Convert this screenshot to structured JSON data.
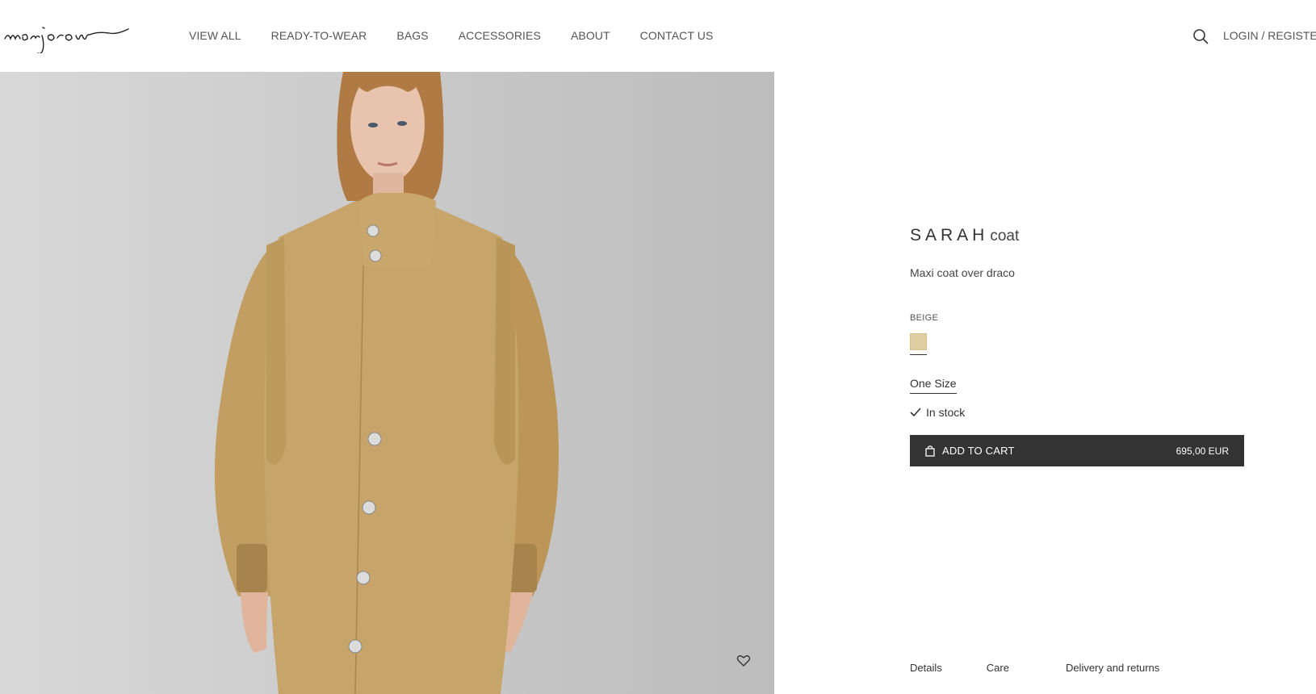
{
  "header": {
    "logo_text": "marjorou",
    "nav": [
      {
        "label": "VIEW ALL"
      },
      {
        "label": "READY-TO-WEAR"
      },
      {
        "label": "BAGS"
      },
      {
        "label": "ACCESSORIES"
      },
      {
        "label": "ABOUT"
      },
      {
        "label": "CONTACT US"
      }
    ],
    "search_icon": "search-icon",
    "login_label": "LOGIN / REGISTER"
  },
  "gallery": {
    "image_subject": "model wearing beige maxi coat",
    "wishlist_icon": "heart-icon"
  },
  "product": {
    "title_main": "SARAH",
    "title_sub": "coat",
    "subtitle": "Maxi coat over draco",
    "color_label": "BEIGE",
    "swatch_color": "#e1cda2",
    "size_label": "One Size",
    "stock_label": "In stock",
    "cart": {
      "label": "ADD TO CART",
      "price": "695,00 EUR",
      "icon": "shopping-bag-icon",
      "bg_color": "#333333"
    }
  },
  "tabs": [
    {
      "label": "Details"
    },
    {
      "label": "Care"
    },
    {
      "label": "Delivery and returns"
    }
  ]
}
